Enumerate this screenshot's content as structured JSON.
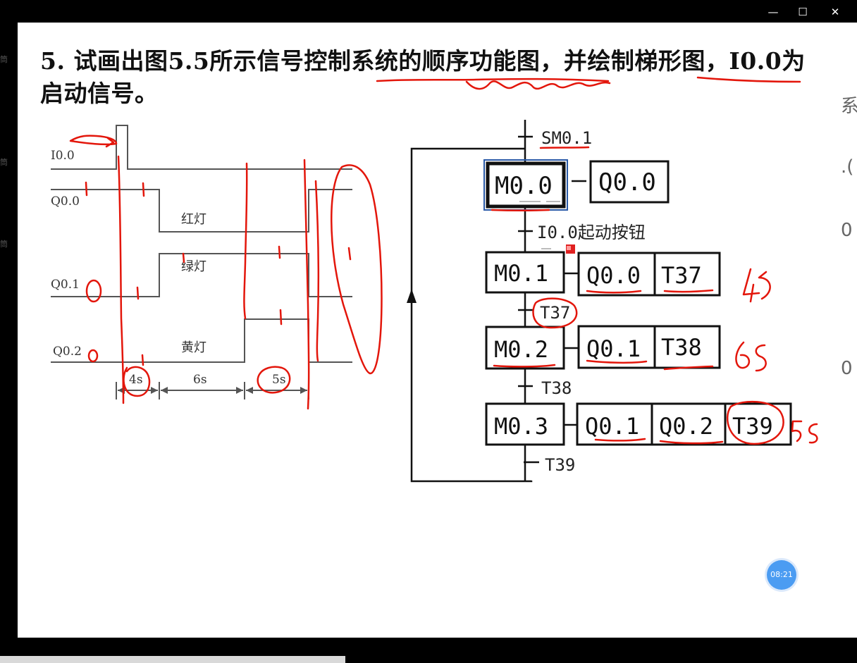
{
  "window": {
    "controls": {
      "minimize": "—",
      "maximize": "☐",
      "close": "✕"
    }
  },
  "problem": {
    "title": "5. 试画出图5.5所示信号控制系统的顺序功能图，并绘制梯形图，I0.0为启动信号。"
  },
  "timing_diagram": {
    "signals": [
      "I0.0",
      "Q0.0",
      "Q0.1",
      "Q0.2"
    ],
    "lamps": {
      "red": "红灯",
      "green": "绿灯",
      "yellow": "黄灯"
    },
    "durations": [
      "4s",
      "6s",
      "5s"
    ]
  },
  "sfc": {
    "initial_transition": "SM0.1",
    "steps": [
      {
        "name": "M0.0",
        "actions": [
          "Q0.0"
        ]
      },
      {
        "name": "M0.1",
        "actions": [
          "Q0.0",
          "T37"
        ]
      },
      {
        "name": "M0.2",
        "actions": [
          "Q0.1",
          "T38"
        ]
      },
      {
        "name": "M0.3",
        "actions": [
          "Q0.1",
          "Q0.2",
          "T39"
        ]
      }
    ],
    "transitions": [
      "I0.0起动按钮",
      "T37",
      "T38",
      "T39"
    ]
  },
  "annotations": {
    "handwritten": [
      "4s",
      "6s",
      "5s"
    ],
    "ink_color": "#e3160b"
  },
  "timer_badge": "08:21",
  "edge_fragments": {
    "left": [
      "筒",
      "筒",
      "筒"
    ],
    "right": [
      "系",
      ".(",
      "0",
      "0"
    ]
  }
}
